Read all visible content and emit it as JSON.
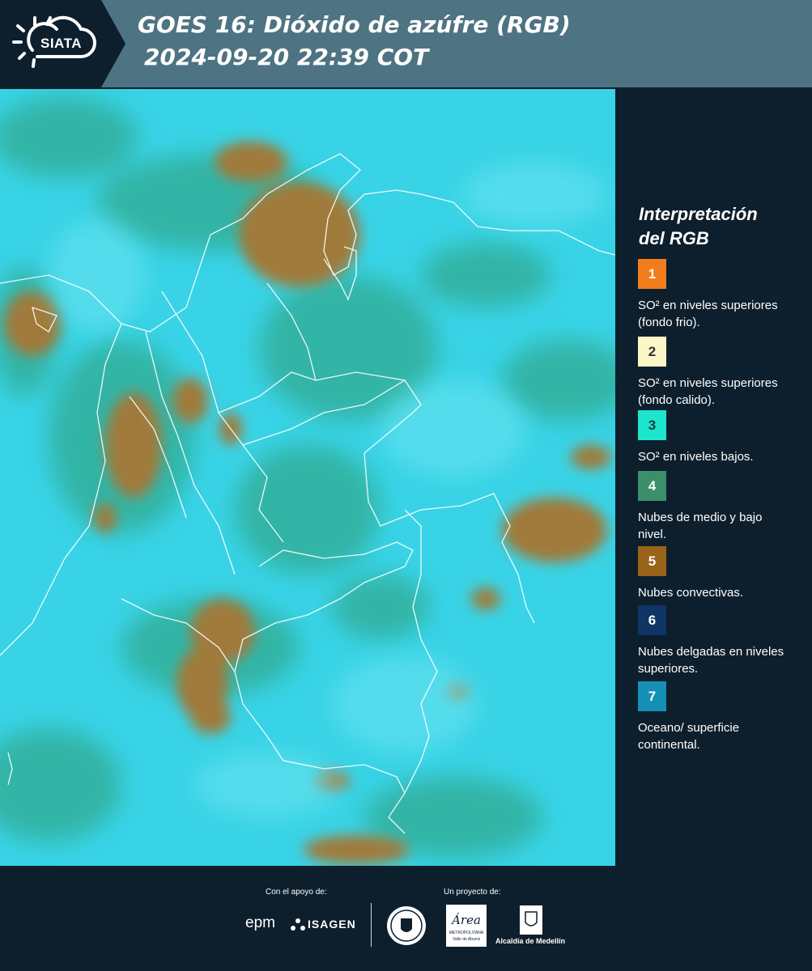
{
  "header": {
    "logo_text": "SIATA",
    "title_line1": "GOES 16: Dióxido de azúfre (RGB)",
    "title_line2": "2024-09-20 22:39 COT"
  },
  "legend": {
    "title_line1": "Interpretación",
    "title_line2": "del RGB",
    "items": [
      {
        "number": "1",
        "color": "#f07c1c",
        "text": "SO² en niveles superiores (fondo frio)."
      },
      {
        "number": "2",
        "color": "#fdf6c7",
        "text": "SO² en niveles superiores (fondo calido)."
      },
      {
        "number": "3",
        "color": "#1de5cc",
        "text": "SO² en niveles bajos."
      },
      {
        "number": "4",
        "color": "#3b8f6b",
        "text": "Nubes de medio y bajo nivel."
      },
      {
        "number": "5",
        "color": "#9a6418",
        "text": "Nubes convectivas."
      },
      {
        "number": "6",
        "color": "#0f3466",
        "text": "Nubes delgadas en niveles superiores."
      },
      {
        "number": "7",
        "color": "#1490b5",
        "text": "Oceano/ superficie continental."
      }
    ]
  },
  "footer": {
    "support_label": "Con el apoyo de:",
    "project_label": "Un proyecto de:",
    "sponsor1": "epm",
    "sponsor2": "ISAGEN",
    "area_main": "Área",
    "area_sub1": "METROPOLITANA",
    "area_sub2": "Valle de Aburrá",
    "alcaldia": "Alcaldía de Medellín"
  }
}
